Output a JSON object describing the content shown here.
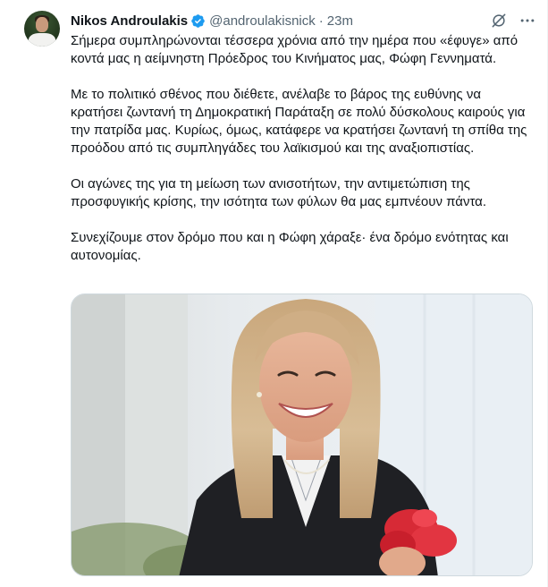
{
  "author": {
    "display_name": "Nikos Androulakis",
    "handle": "@androulakisnick",
    "separator": "·",
    "timestamp": "23m",
    "verified": true,
    "verified_color": "#1d9bf0"
  },
  "actions": {
    "grok_icon": "grok-icon",
    "more_icon": "more-dots-icon"
  },
  "tweet": {
    "paragraphs": [
      "Σήμερα συμπληρώνονται τέσσερα χρόνια από την ημέρα που «έφυγε» από κοντά μας η αείμνηστη Πρόεδρος του Κινήματος μας, Φώφη Γεννηματά.",
      "Με το πολιτικό σθένος που διέθετε, ανέλαβε το βάρος της ευθύνης να κρατήσει ζωντανή τη Δημοκρατική Παράταξη σε πολύ δύσκολους καιρούς για την πατρίδα μας. Κυρίως, όμως, κατάφερε να κρατήσει ζωντανή τη σπίθα της προόδου από τις συμπληγάδες του λαϊκισμού και της αναξιοπιστίας.",
      "Οι αγώνες της για τη μείωση των ανισοτήτων, την αντιμετώπιση της προσφυγικής κρίσης, την ισότητα των φύλων θα μας εμπνέουν πάντα.",
      "Συνεχίζουμε στον δρόμο που και η Φώφη χάραξε· ένα δρόμο ενότητας και αυτονομίας."
    ]
  },
  "media": {
    "type": "photo"
  }
}
